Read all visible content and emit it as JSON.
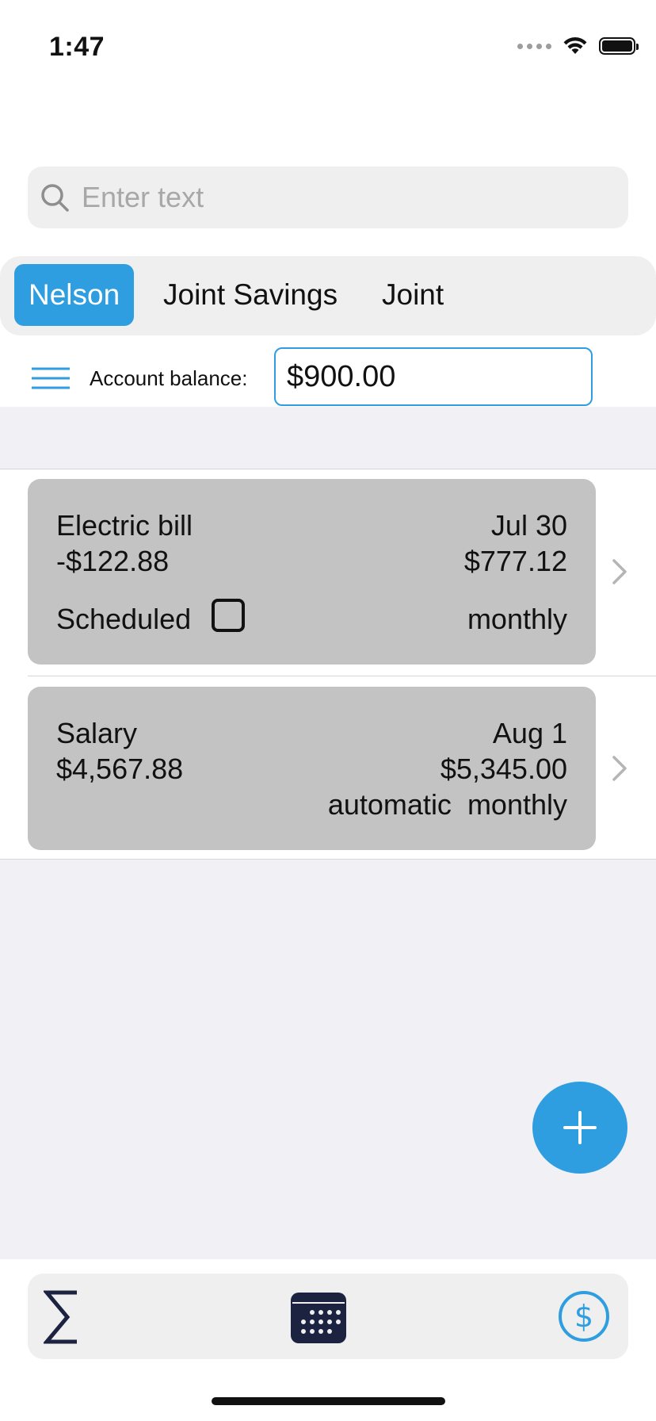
{
  "status_bar": {
    "time": "1:47",
    "icons": [
      "signal-dots-icon",
      "wifi-icon",
      "battery-icon"
    ]
  },
  "search": {
    "placeholder": "Enter text",
    "value": "",
    "icon": "search-icon"
  },
  "tabs": [
    {
      "label": "Nelson",
      "active": true
    },
    {
      "label": "Joint Savings",
      "active": false
    },
    {
      "label": "Joint",
      "active": false
    }
  ],
  "balance": {
    "label": "Account balance:",
    "value": "$900.00",
    "menu_icon": "hamburger-menu-icon"
  },
  "transactions": [
    {
      "name": "Electric bill",
      "date": "Jul 30",
      "amount": "-$122.88",
      "running_balance": "$777.12",
      "scheduled_label": "Scheduled",
      "scheduled_checked": false,
      "frequency": "monthly"
    },
    {
      "name": "Salary",
      "date": "Aug 1",
      "amount": "$4,567.88",
      "running_balance": "$5,345.00",
      "frequency": "automatic  monthly"
    }
  ],
  "fab": {
    "icon": "plus-icon"
  },
  "bottom_bar": {
    "icons": [
      "sigma-icon",
      "calendar-icon",
      "dollar-circle-icon"
    ]
  },
  "colors": {
    "accent": "#2f9ee0",
    "card_bg": "#c3c3c3",
    "list_bg": "#f1f1f5",
    "tab_bg": "#efefef"
  }
}
